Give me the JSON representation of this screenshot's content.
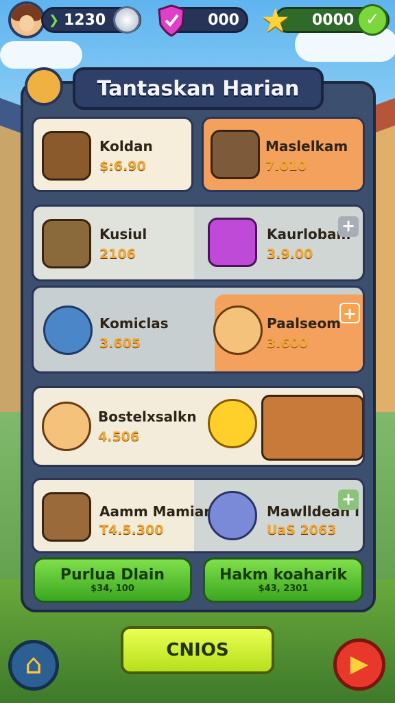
{
  "topbar": {
    "coins": "1230",
    "shield_value": "000",
    "star_value": "0000",
    "icons": [
      "avatar",
      "chevron-right-icon",
      "gem-icon",
      "shield-icon",
      "star-icon",
      "heart-icon"
    ]
  },
  "panel": {
    "title": "Tantaskan Harian"
  },
  "tasks": [
    {
      "label": "Koldan",
      "value": "$:6.90",
      "icon": "crate-icon"
    },
    {
      "label": "Maslelkam",
      "value": "7.010",
      "icon": "scroll-icon"
    },
    {
      "label": "Kusiul",
      "value": "2106",
      "icon": "map-icon"
    },
    {
      "label": "Kaurlobam",
      "value": "3.9.00",
      "icon": "book-icon"
    },
    {
      "label": "Komiclas",
      "value": "3.605",
      "icon": "chest-icon"
    },
    {
      "label": "Paalseom",
      "value": "3.600",
      "icon": "worker-icon"
    },
    {
      "label": "Bostelxsalkn",
      "value": "4.506",
      "icon": "builder-icon"
    },
    {
      "label": "Aamm Mamian",
      "value": "T4.5.300",
      "icon": "wood-crate-icon"
    },
    {
      "label": "Mawlldean l",
      "value": "UaS 2063",
      "icon": "compass-icon"
    }
  ],
  "buttons": {
    "left": {
      "label": "Purlua Dlain",
      "sub": "$34, 100"
    },
    "right": {
      "label": "Hakm koaharik",
      "sub": "$43, 2301"
    },
    "main": "CNIOS"
  },
  "colors": {
    "panel": "#3d4f6e",
    "orange_card": "#f3a15c",
    "cream_card": "#f6eedb",
    "grey_card": "#cfd6d4",
    "green_button": "#5cc82e",
    "lime_button": "#d4f032"
  }
}
